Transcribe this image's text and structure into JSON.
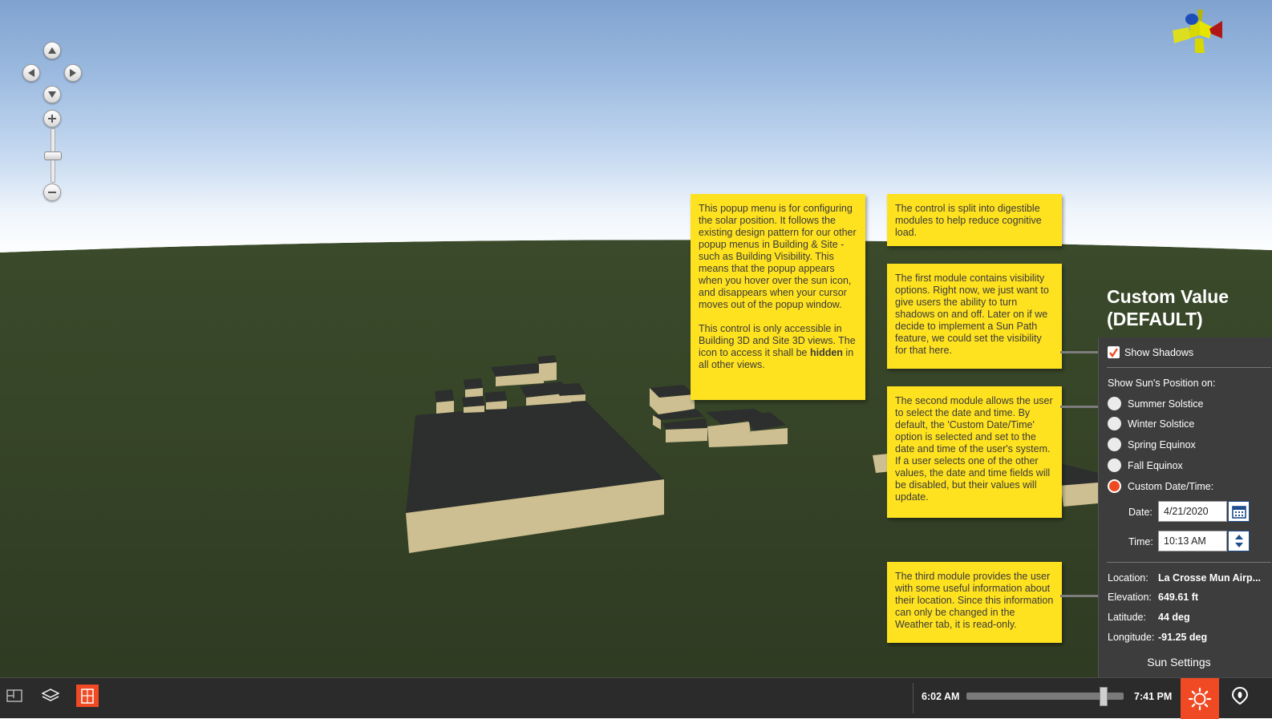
{
  "colors": {
    "accent": "#f04a24",
    "note_bg": "#ffe21f",
    "panel_bg": "#3d3d3d",
    "ground": "#333f24",
    "building_top": "#2c2f2d",
    "building_side": "#cdbf91"
  },
  "notes": {
    "popup_intro": "This popup menu is for configuring the solar position. It follows the existing design pattern for our other popup menus in Building & Site - such as Building Visibility. This means that the popup appears when you hover over the sun icon, and disappears when your cursor moves out of the popup window.",
    "access_prefix": "This control is only accessible in Building 3D and Site 3D views. The icon to access it shall be ",
    "access_bold": "hidden",
    "access_suffix": " in all other views.",
    "modules": "The control is split into digestible modules to help reduce cognitive load.",
    "first_module": "The first module contains visibility options. Right now, we just want to give users the ability to turn shadows on and off. Later on if we decide to implement a Sun Path feature, we could set the visibility for that here.",
    "second_module": "The second module allows the user to select the date and time. By default, the 'Custom Date/Time' option is selected and set to the date and time of the user's system. If a user selects one of the other values, the date and time fields will be disabled, but their values will update.",
    "third_module": "The third module provides the user with some useful information about their location. Since this information can only be changed in the Weather tab, it is read-only."
  },
  "popup": {
    "title_line1": "Custom Value",
    "title_line2": "(DEFAULT)",
    "show_shadows_label": "Show Shadows",
    "show_shadows_checked": true,
    "sun_position_heading": "Show Sun's Position on:",
    "options": [
      {
        "label": "Summer Solstice",
        "selected": false
      },
      {
        "label": "Winter Solstice",
        "selected": false
      },
      {
        "label": "Spring Equinox",
        "selected": false
      },
      {
        "label": "Fall Equinox",
        "selected": false
      },
      {
        "label": "Custom Date/Time:",
        "selected": true
      }
    ],
    "date_label": "Date:",
    "date_value": "4/21/2020",
    "time_label": "Time:",
    "time_value": "10:13 AM",
    "location_label": "Location:",
    "location_value": "La Crosse Mun Airp...",
    "elevation_label": "Elevation:",
    "elevation_value": "649.61 ft",
    "latitude_label": "Latitude:",
    "latitude_value": "44 deg",
    "longitude_label": "Longitude:",
    "longitude_value": "-91.25 deg",
    "footer_label": "Sun Settings"
  },
  "bottom_bar": {
    "sunrise_time": "6:02 AM",
    "sunset_time": "7:41 PM",
    "time_slider_fraction": 0.87
  }
}
